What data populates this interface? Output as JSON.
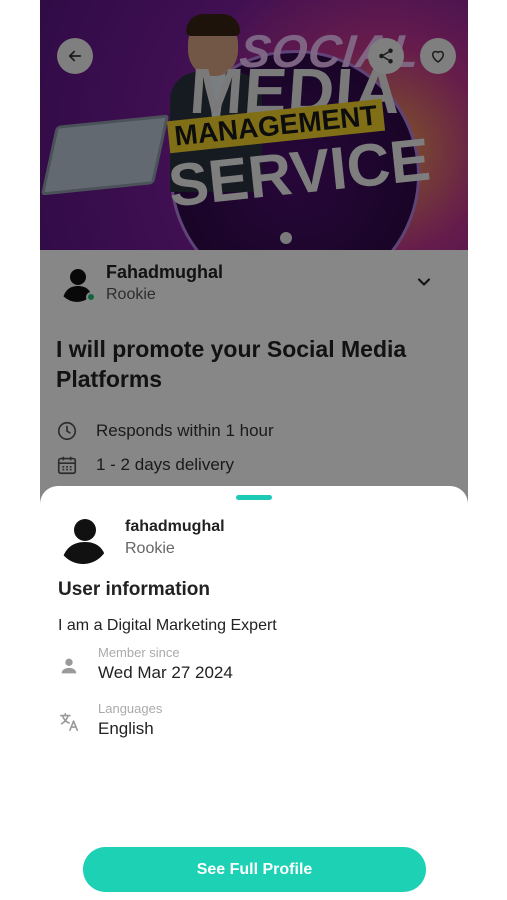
{
  "hero": {
    "banner_words": [
      "SOCIAL",
      "MEDIA",
      "MANAGEMENT",
      "SERVICE"
    ]
  },
  "seller": {
    "name": "Fahadmughal",
    "level": "Rookie",
    "online": true
  },
  "gig": {
    "title": "I will promote your Social Media Platforms",
    "response_time": "Responds within 1 hour",
    "delivery": "1 - 2 days delivery"
  },
  "sheet": {
    "username": "fahadmughal",
    "level": "Rookie",
    "section_title": "User information",
    "bio": "I am a Digital Marketing Expert",
    "member_since_label": "Member since",
    "member_since_value": "Wed Mar 27 2024",
    "languages_label": "Languages",
    "languages_value": "English",
    "cta_label": "See Full Profile"
  },
  "icons": {
    "back": "arrow-left-icon",
    "share": "share-icon",
    "favorite": "heart-icon",
    "expand": "chevron-down-icon",
    "clock": "clock-icon",
    "calendar": "calendar-icon",
    "person": "person-icon",
    "translate": "translate-icon"
  },
  "colors": {
    "accent": "#1dd1b5",
    "online": "#1dbf73"
  }
}
